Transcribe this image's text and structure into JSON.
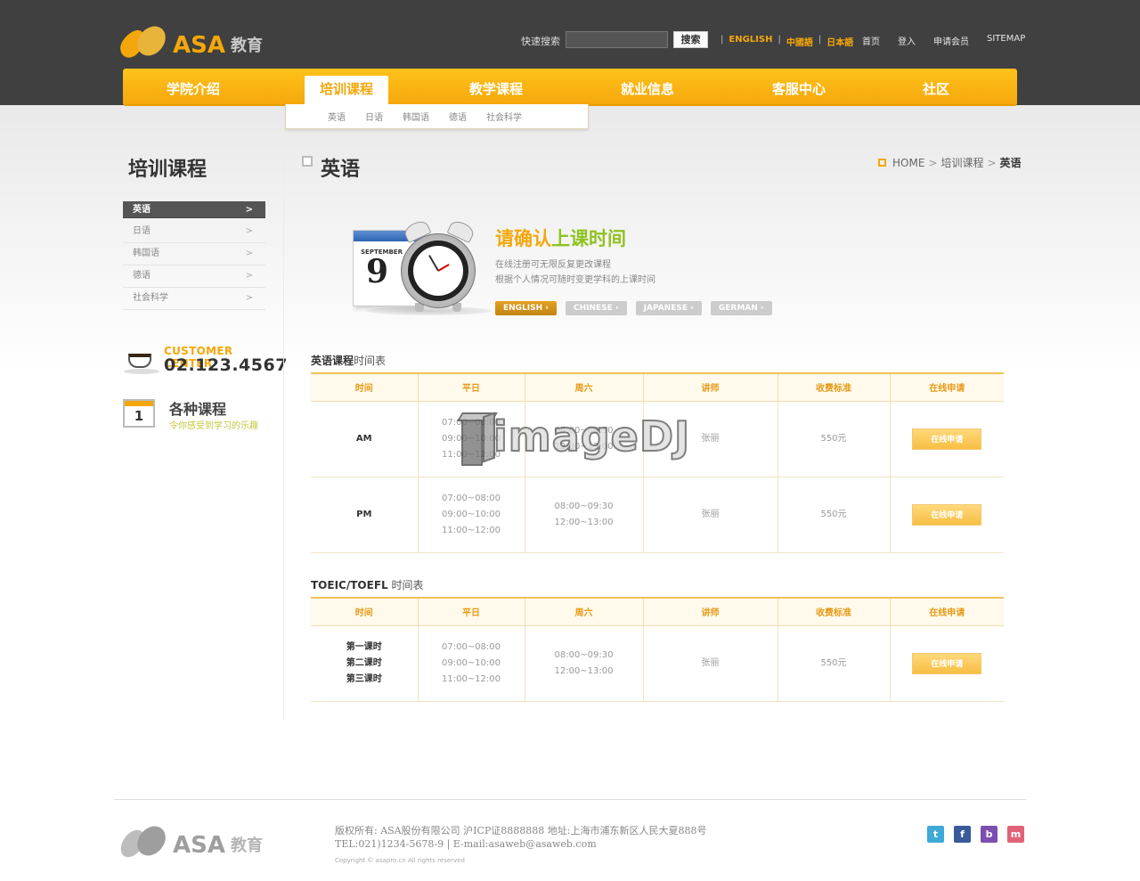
{
  "brand": {
    "name": "ASA",
    "sub": "教育"
  },
  "header": {
    "search_label": "快速搜索",
    "search_placeholder": "",
    "search_button": "搜索",
    "languages": [
      "ENGLISH",
      "中國語",
      "日本語"
    ],
    "util_links": [
      "首页",
      "登入",
      "申请会员",
      "SITEMAP"
    ]
  },
  "nav": {
    "items": [
      "学院介绍",
      "培训课程",
      "教学课程",
      "就业信息",
      "客服中心",
      "社区"
    ],
    "active": "培训课程",
    "sub_items": [
      "英语",
      "日语",
      "韩国语",
      "德语",
      "社会科学"
    ]
  },
  "sidebar": {
    "title": "培训课程",
    "items": [
      "英语",
      "日语",
      "韩国语",
      "德语",
      "社会科学"
    ],
    "arrow": ">",
    "customer_center": {
      "label": "CUSTOMER CENTER",
      "phone": "02.123.4567"
    },
    "course_box": {
      "title": "各种课程",
      "subtitle": "令你感受到学习的乐趣",
      "calendar_day": "1"
    }
  },
  "page": {
    "title": "英语",
    "breadcrumb": [
      "HOME",
      "培训课程",
      "英语"
    ]
  },
  "promo": {
    "calendar_month": "SEPTEMBER",
    "calendar_day": "9",
    "title_part1": "请确认",
    "title_part2": "上课时间",
    "desc_lines": [
      "在线注册可无限反复更改课程",
      "根据个人情况可随时变更学科的上课时间"
    ],
    "buttons": [
      "ENGLISH",
      "CHINESE",
      "JAPANESE",
      "GERMAN"
    ]
  },
  "table1": {
    "title_bold": "英语课程",
    "title_rest": "时间表",
    "headers": [
      "时间",
      "平日",
      "周六",
      "讲师",
      "收费标准",
      "在线申请"
    ],
    "rows": [
      {
        "period": "AM",
        "weekday": [
          "07:00~08:00",
          "09:00~10:00",
          "11:00~12:00"
        ],
        "saturday": [
          "08:00~09:30",
          "12:00~13:00"
        ],
        "teacher": "张丽",
        "fee": "550元",
        "apply": "在线申请"
      },
      {
        "period": "PM",
        "weekday": [
          "07:00~08:00",
          "09:00~10:00",
          "11:00~12:00"
        ],
        "saturday": [
          "08:00~09:30",
          "12:00~13:00"
        ],
        "teacher": "张丽",
        "fee": "550元",
        "apply": "在线申请"
      }
    ]
  },
  "table2": {
    "title_bold": "TOEIC/TOEFL",
    "title_rest": " 时间表",
    "headers": [
      "时间",
      "平日",
      "周六",
      "讲师",
      "收费标准",
      "在线申请"
    ],
    "rows": [
      {
        "periods": [
          "第一课时",
          "第二课时",
          "第三课时"
        ],
        "weekday": [
          "07:00~08:00",
          "09:00~10:00",
          "11:00~12:00"
        ],
        "saturday": [
          "08:00~09:30",
          "12:00~13:00"
        ],
        "teacher": "张丽",
        "fee": "550元",
        "apply": "在线申请"
      }
    ]
  },
  "watermark": "imageDJ",
  "footer": {
    "line1": "版权所有: ASA股份有限公司 沪ICP证8888888 地址:上海市浦东新区人民大夏888号",
    "line2": "TEL:021)1234-5678-9 | E-mail:asaweb@asaweb.com",
    "copyright": "Copyright © asapro.cn All rights reserved",
    "social_icons": [
      "twitter-icon",
      "facebook-icon",
      "blog-icon",
      "me2day-icon"
    ]
  },
  "colors": {
    "accent": "#f4a70a",
    "header_bg": "#404040",
    "green": "#8fc21f"
  }
}
